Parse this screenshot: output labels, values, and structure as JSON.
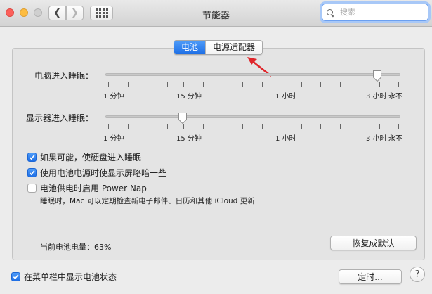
{
  "window": {
    "title": "节能器"
  },
  "search": {
    "placeholder": "搜索"
  },
  "tabs": [
    {
      "label": "电池",
      "active": true
    },
    {
      "label": "电源适配器",
      "active": false
    }
  ],
  "computer_sleep": {
    "label": "电脑进入睡眠：",
    "tick_labels": [
      "1 分钟",
      "15 分钟",
      "1 小时",
      "3 小时",
      "永不"
    ],
    "value": "3 小时"
  },
  "display_sleep": {
    "label": "显示器进入睡眠：",
    "tick_labels": [
      "1 分钟",
      "15 分钟",
      "1 小时",
      "3 小时",
      "永不"
    ],
    "value": "15 分钟"
  },
  "options": [
    {
      "label": "如果可能，使硬盘进入睡眠",
      "checked": true
    },
    {
      "label": "使用电池电源时使显示屏略暗一些",
      "checked": true
    },
    {
      "label": "电池供电时启用 Power Nap",
      "checked": false
    }
  ],
  "power_nap_note": "睡眠时，Mac 可以定期检查新电子邮件、日历和其他 iCloud 更新",
  "battery_level": "当前电池电量：63%",
  "restore_defaults_label": "恢复成默认",
  "menubar_option": {
    "label": "在菜单栏中显示电池状态",
    "checked": true
  },
  "schedule_label": "定时...",
  "help_label": "?",
  "colors": {
    "accent": "#1e6fe6",
    "arrow": "#e0262b"
  }
}
